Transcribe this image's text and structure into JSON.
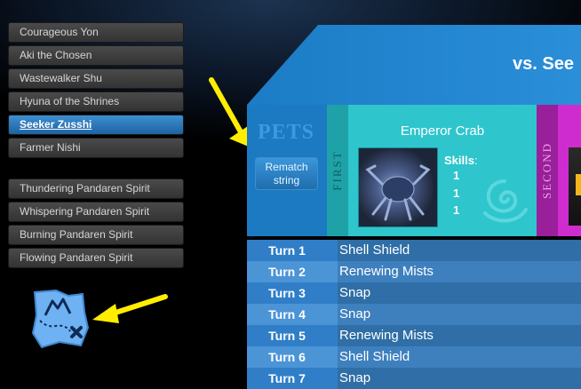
{
  "nav": {
    "group_a": [
      "Courageous Yon",
      "Aki the Chosen",
      "Wastewalker Shu",
      "Hyuna of the Shrines",
      "Seeker Zusshi",
      "Farmer Nishi"
    ],
    "group_b": [
      "Thundering Pandaren Spirit",
      "Whispering Pandaren Spirit",
      "Burning Pandaren Spirit",
      "Flowing Pandaren Spirit"
    ],
    "active": "Seeker Zusshi"
  },
  "header": {
    "title": "vs. See"
  },
  "pets_column": {
    "label": "PETS",
    "rematch_label": "Rematch string"
  },
  "first": {
    "slot_label": "FIRST",
    "pet_name": "Emperor Crab",
    "skills_label": "Skills",
    "skills": [
      "1",
      "1",
      "1"
    ]
  },
  "second": {
    "slot_label": "SECOND"
  },
  "turns": [
    {
      "label": "Turn 1",
      "move": "Shell Shield"
    },
    {
      "label": "Turn 2",
      "move": "Renewing Mists"
    },
    {
      "label": "Turn 3",
      "move": "Snap"
    },
    {
      "label": "Turn 4",
      "move": "Snap"
    },
    {
      "label": "Turn 5",
      "move": "Renewing Mists"
    },
    {
      "label": "Turn 6",
      "move": "Shell Shield"
    },
    {
      "label": "Turn 7",
      "move": "Snap"
    }
  ],
  "icons": {
    "map": "treasure-map-icon",
    "arrow": "arrow-icon",
    "swirl": "water-swirl-icon"
  },
  "colors": {
    "accent": "#1b7ac1",
    "first_slot": "#2fc5cc",
    "second_slot": "#cf2ccf",
    "arrow": "#ffee00"
  }
}
